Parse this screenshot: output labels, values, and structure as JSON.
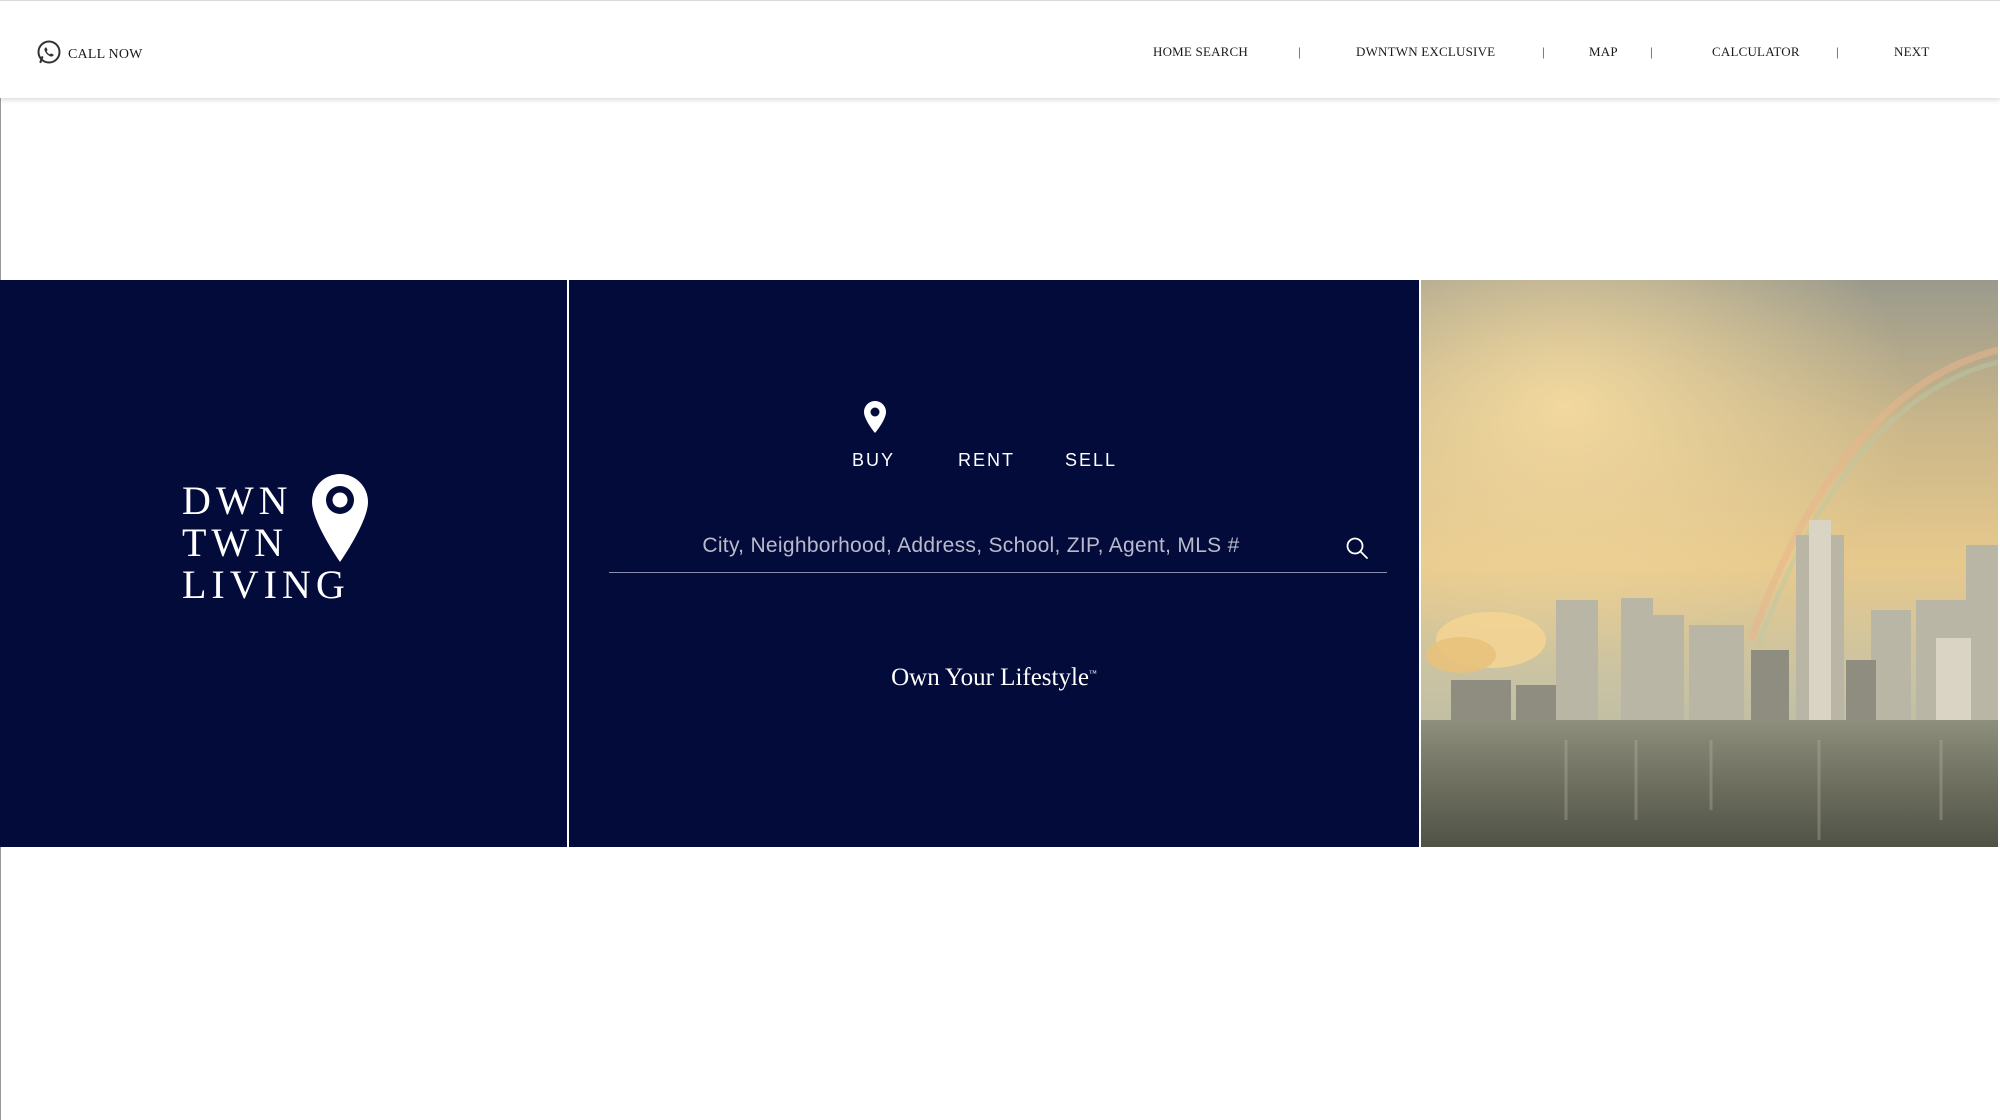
{
  "header": {
    "call_now_label": "CALL NOW",
    "call_icon": "whatsapp-icon",
    "nav": [
      {
        "label": "HOME SEARCH"
      },
      {
        "label": "DWNTWN EXCLUSIVE"
      },
      {
        "label": "MAP"
      },
      {
        "label": "CALCULATOR"
      },
      {
        "label": "NEXT"
      }
    ],
    "separator": "|"
  },
  "logo": {
    "lines": [
      "DWN",
      "TWN",
      "LIVING"
    ],
    "icon": "map-pin-icon"
  },
  "search": {
    "tabs": [
      {
        "label": "BUY",
        "active": true
      },
      {
        "label": "RENT"
      },
      {
        "label": "SELL"
      }
    ],
    "placeholder": "City, Neighborhood, Address, School, ZIP, Agent, MLS #",
    "value": "",
    "icon": "search-icon",
    "tagline": "Own Your Lifestyle",
    "tagline_mark": "™"
  },
  "photo": {
    "description_icon": "city-skyline-photo"
  },
  "colors": {
    "navy": "#030b3a",
    "white": "#ffffff",
    "nav_text": "#1a1a1a"
  }
}
